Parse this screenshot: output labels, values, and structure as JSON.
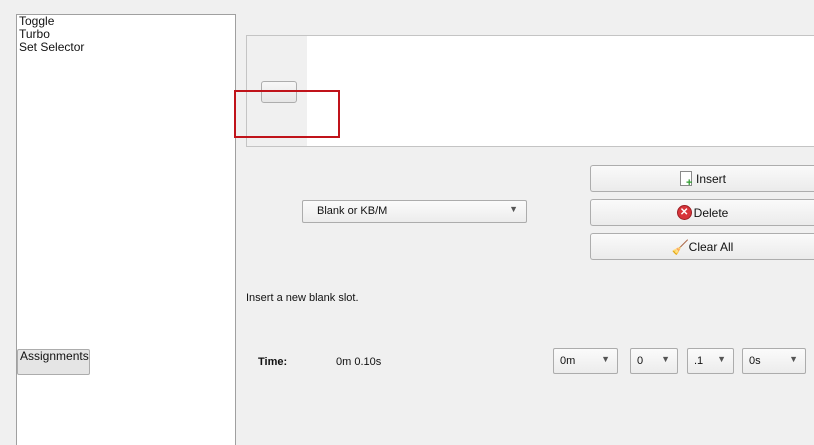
{
  "sidebar": {
    "items": [
      {
        "label": "Assignments",
        "selected": true
      },
      {
        "label": "Toggle",
        "selected": false
      },
      {
        "label": "Turbo",
        "selected": false
      },
      {
        "label": "Set Selector",
        "selected": false
      }
    ]
  },
  "slot_type": {
    "selected": "Blank or KB/M"
  },
  "buttons": {
    "insert": "Insert",
    "delete": "Delete",
    "clear_all": "Clear All"
  },
  "status_text": "Insert a new blank slot.",
  "time": {
    "label": "Time:",
    "value": "0m 0.10s",
    "minutes": "0m",
    "seconds": "0",
    "tenths": ".1",
    "zero": "0s"
  },
  "icons": {
    "insert": "insert-document-icon",
    "delete": "delete-icon",
    "clear_all": "broom-icon",
    "dropdown": "chevron-down-icon"
  },
  "colors": {
    "highlight": "#c0131a",
    "delete_icon": "#d8343a",
    "insert_plus": "#2e9b2e",
    "broom": "#d9a21f"
  }
}
